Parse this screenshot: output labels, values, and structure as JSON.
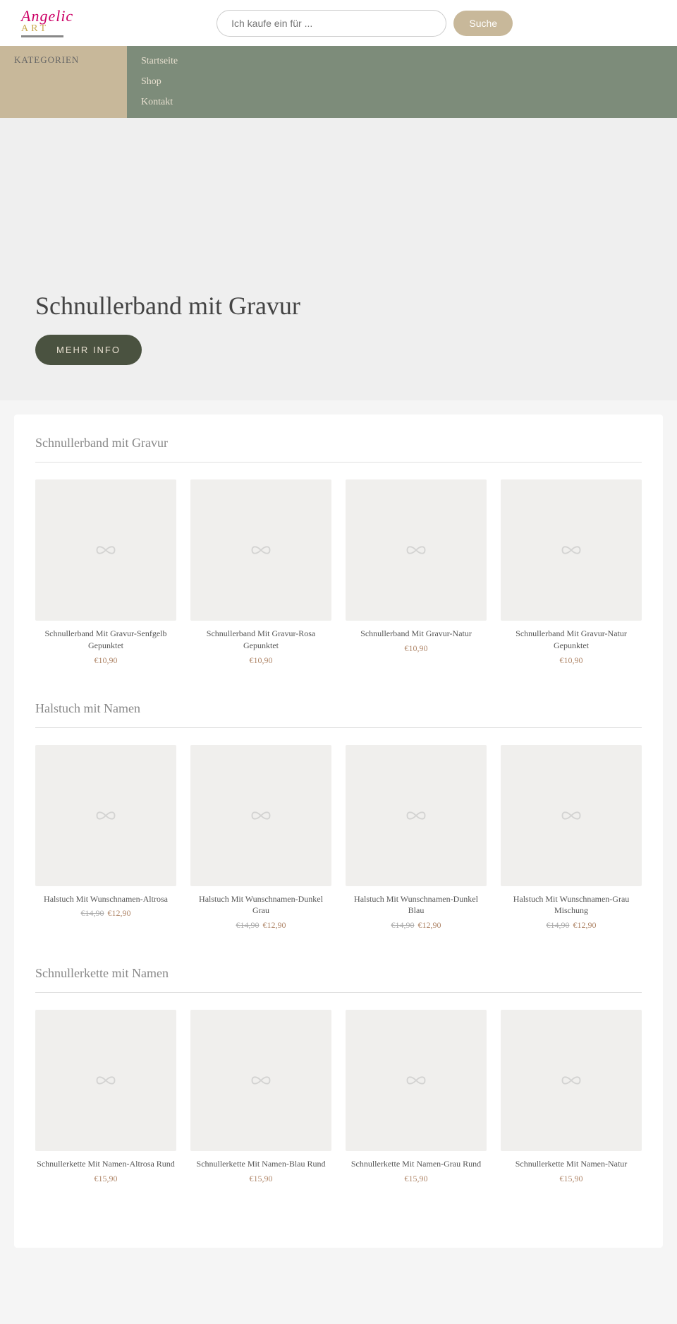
{
  "header": {
    "logo_angelic": "Angelic",
    "logo_art": "ART",
    "search_placeholder": "Ich kaufe ein für ...",
    "search_button": "Suche"
  },
  "nav": {
    "category_label": "KATEGORIEN",
    "links": [
      {
        "label": "Startseite",
        "id": "home"
      },
      {
        "label": "Shop",
        "id": "shop"
      },
      {
        "label": "Kontakt",
        "id": "contact"
      }
    ]
  },
  "hero": {
    "title": "Schnullerband mit Gravur",
    "button": "MEHR INFO"
  },
  "sections": [
    {
      "id": "schnullerband",
      "title": "Schnullerband mit Gravur",
      "products": [
        {
          "name": "Schnullerband Mit Gravur-Senfgelb Gepunktet",
          "price": "€10,90",
          "old_price": null
        },
        {
          "name": "Schnullerband Mit Gravur-Rosa Gepunktet",
          "price": "€10,90",
          "old_price": null
        },
        {
          "name": "Schnullerband Mit Gravur-Natur",
          "price": "€10,90",
          "old_price": null
        },
        {
          "name": "Schnullerband Mit Gravur-Natur Gepunktet",
          "price": "€10,90",
          "old_price": null
        }
      ]
    },
    {
      "id": "halstuch",
      "title": "Halstuch mit Namen",
      "products": [
        {
          "name": "Halstuch Mit Wunschnamen-Altrosa",
          "price": "€12,90",
          "old_price": "€14,90"
        },
        {
          "name": "Halstuch Mit Wunschnamen-Dunkel Grau",
          "price": "€12,90",
          "old_price": "€14,90"
        },
        {
          "name": "Halstuch Mit Wunschnamen-Dunkel Blau",
          "price": "€12,90",
          "old_price": "€14,90"
        },
        {
          "name": "Halstuch Mit Wunschnamen-Grau Mischung",
          "price": "€12,90",
          "old_price": "€14,90"
        }
      ]
    },
    {
      "id": "schnullerkette",
      "title": "Schnullerkette mit Namen",
      "products": [
        {
          "name": "Schnullerkette Mit Namen-Altrosa Rund",
          "price": "€15,90",
          "old_price": null
        },
        {
          "name": "Schnullerkette Mit Namen-Blau Rund",
          "price": "€15,90",
          "old_price": null
        },
        {
          "name": "Schnullerkette Mit Namen-Grau Rund",
          "price": "€15,90",
          "old_price": null
        },
        {
          "name": "Schnullerkette Mit Namen-Natur",
          "price": "€15,90",
          "old_price": null
        }
      ]
    }
  ]
}
